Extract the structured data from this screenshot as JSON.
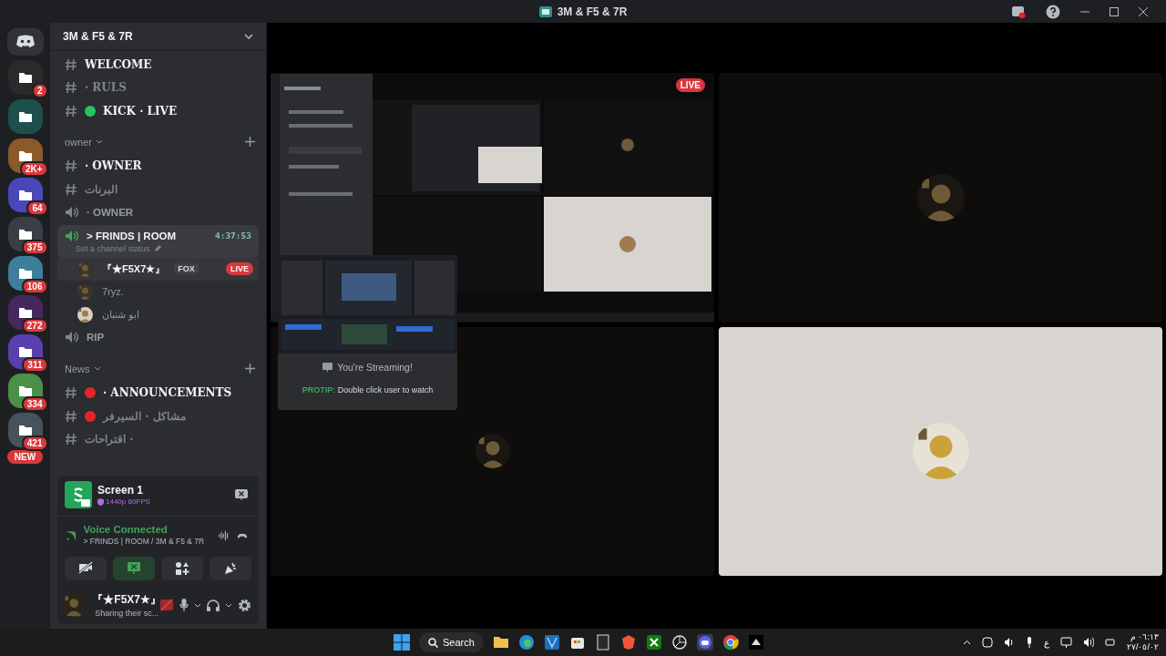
{
  "window": {
    "title": "3M & F5 & 7R"
  },
  "servers": [
    {
      "badge": "2",
      "color": "#2a2a2a"
    },
    {
      "color": "#1d4f4c"
    },
    {
      "badge": "2K+",
      "color": "#8a5a2b"
    },
    {
      "badge": "64",
      "color": "#4a47b8"
    },
    {
      "badge": "375",
      "color": "#3a3f47"
    },
    {
      "badge": "106",
      "color": "#3d7e99"
    },
    {
      "badge": "272",
      "color": "#46285f"
    },
    {
      "badge": "311",
      "color": "#5a3fb0"
    },
    {
      "badge": "334",
      "color": "#4c8f46"
    },
    {
      "badge": "421",
      "color": "#47525a"
    }
  ],
  "new_badge": "NEW",
  "server_name": "3M & F5 & 7R",
  "channels": [
    {
      "kind": "text",
      "name": "WELCOME",
      "unread": true
    },
    {
      "kind": "text",
      "name": "· RULS",
      "unread": false
    },
    {
      "kind": "text",
      "name": "KICK · LIVE",
      "unread": true,
      "color": "#23c55e"
    },
    {
      "kind": "category",
      "name": "owner"
    },
    {
      "kind": "text",
      "name": "· OWNER",
      "unread": true
    },
    {
      "kind": "text",
      "name": "البرنات",
      "unread": false
    },
    {
      "kind": "voice",
      "name": "· OWNER",
      "unread": false,
      "selected": false
    },
    {
      "kind": "voice",
      "name": "> FRINDS | ROOM",
      "unread": true,
      "selected": true,
      "timer": "4:37:53",
      "status": "Set a channel status",
      "members": [
        {
          "name": "『★F5X7★』",
          "tag": "FOX",
          "live_badge": "LIVE",
          "speaking": true
        },
        {
          "name": "7ryz.",
          "speaking": false
        },
        {
          "name": "ابو شنبان",
          "speaking": false
        }
      ]
    },
    {
      "kind": "voice",
      "name": "RIP",
      "unread": false,
      "selected": false
    },
    {
      "kind": "category",
      "name": "News"
    },
    {
      "kind": "text",
      "name": "· ANNOUNCEMENTS",
      "unread": true,
      "color": "#e5242b"
    },
    {
      "kind": "text",
      "name": "مشاكل · السيرفر",
      "unread": false,
      "color": "#e5242b"
    },
    {
      "kind": "text",
      "name": "اقتراحات ·",
      "unread": false
    }
  ],
  "stream": {
    "title": "Screen 1",
    "quality": "1440p 60FPS"
  },
  "voice": {
    "status": "Voice Connected",
    "channel": "> FRINDS | ROOM / 3M & F5 & 7R"
  },
  "actions": [
    {
      "kind": "camera",
      "on": false
    },
    {
      "kind": "screen",
      "on": true
    },
    {
      "kind": "activities",
      "on": false
    },
    {
      "kind": "soundboard",
      "on": false
    }
  ],
  "user": {
    "name": "『★F5X7★』",
    "status": "Sharing their sc..."
  },
  "tiles": [
    {
      "kind": "stream",
      "live_badge": "LIVE"
    },
    {
      "kind": "user",
      "light": false
    },
    {
      "kind": "user",
      "light": false
    },
    {
      "kind": "user",
      "light": true
    }
  ],
  "popup": {
    "title": "You're Streaming!",
    "tip": "**PROTIP:** Double click user to watch"
  },
  "taskbar": {
    "search": "Search",
    "language": "ع",
    "time": "٠٦:١٣ م",
    "date": "٢٧/٠٥/٠٢"
  }
}
